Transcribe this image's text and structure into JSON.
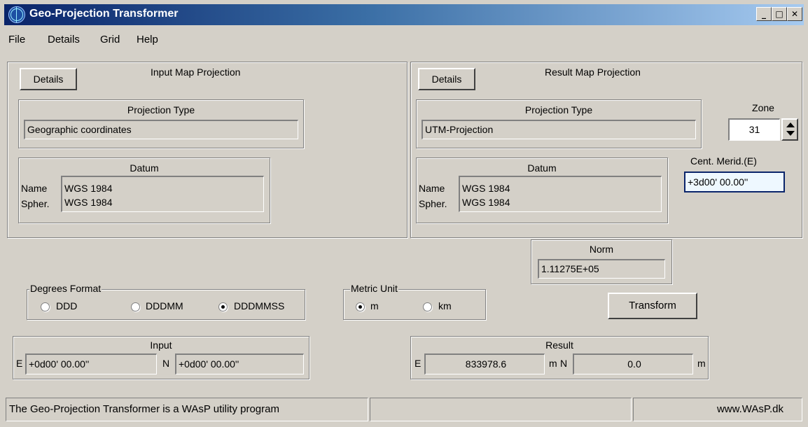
{
  "window": {
    "title": "Geo-Projection Transformer",
    "minimize": "_",
    "maximize": "□",
    "close": "✕"
  },
  "menu": [
    "File",
    "Details",
    "Grid",
    "Help"
  ],
  "input_projection": {
    "group_title": "Input Map Projection",
    "details_button": "Details",
    "projection_type_title": "Projection Type",
    "projection_type": "Geographic coordinates",
    "datum_title": "Datum",
    "name_label": "Name",
    "name": "WGS 1984",
    "spheroid_label": "Spher.",
    "spheroid": "WGS 1984"
  },
  "result_projection": {
    "group_title": "Result Map Projection",
    "details_button": "Details",
    "projection_type_title": "Projection Type",
    "projection_type": "UTM-Projection",
    "datum_title": "Datum",
    "name_label": "Name",
    "name": "WGS 1984",
    "spheroid_label": "Spher.",
    "spheroid": "WGS 1984",
    "zone_label": "Zone",
    "zone": "31",
    "cent_merid_label": "Cent. Merid.(E)",
    "cent_merid": "+3d00' 00.00''"
  },
  "norm": {
    "title": "Norm",
    "value": "1.11275E+05"
  },
  "degrees_format": {
    "title": "Degrees Format",
    "options": [
      "DDD",
      "DDDMM",
      "DDDMMSS"
    ],
    "selected": "DDDMMSS"
  },
  "metric_unit": {
    "title": "Metric Unit",
    "options": [
      "m",
      "km"
    ],
    "selected": "m"
  },
  "transform_button": "Transform",
  "input": {
    "title": "Input",
    "e_label": "E",
    "e_value": "+0d00' 00.00''",
    "n_label": "N",
    "n_value": "+0d00' 00.00''"
  },
  "result": {
    "title": "Result",
    "e_label": "E",
    "e_value": "833978.6",
    "e_unit": "m",
    "n_label": "N",
    "n_value": "0.0",
    "n_unit": "m"
  },
  "status": {
    "left": "The Geo-Projection Transformer is a WAsP utility program",
    "middle": "",
    "right": "www.WAsP.dk"
  }
}
